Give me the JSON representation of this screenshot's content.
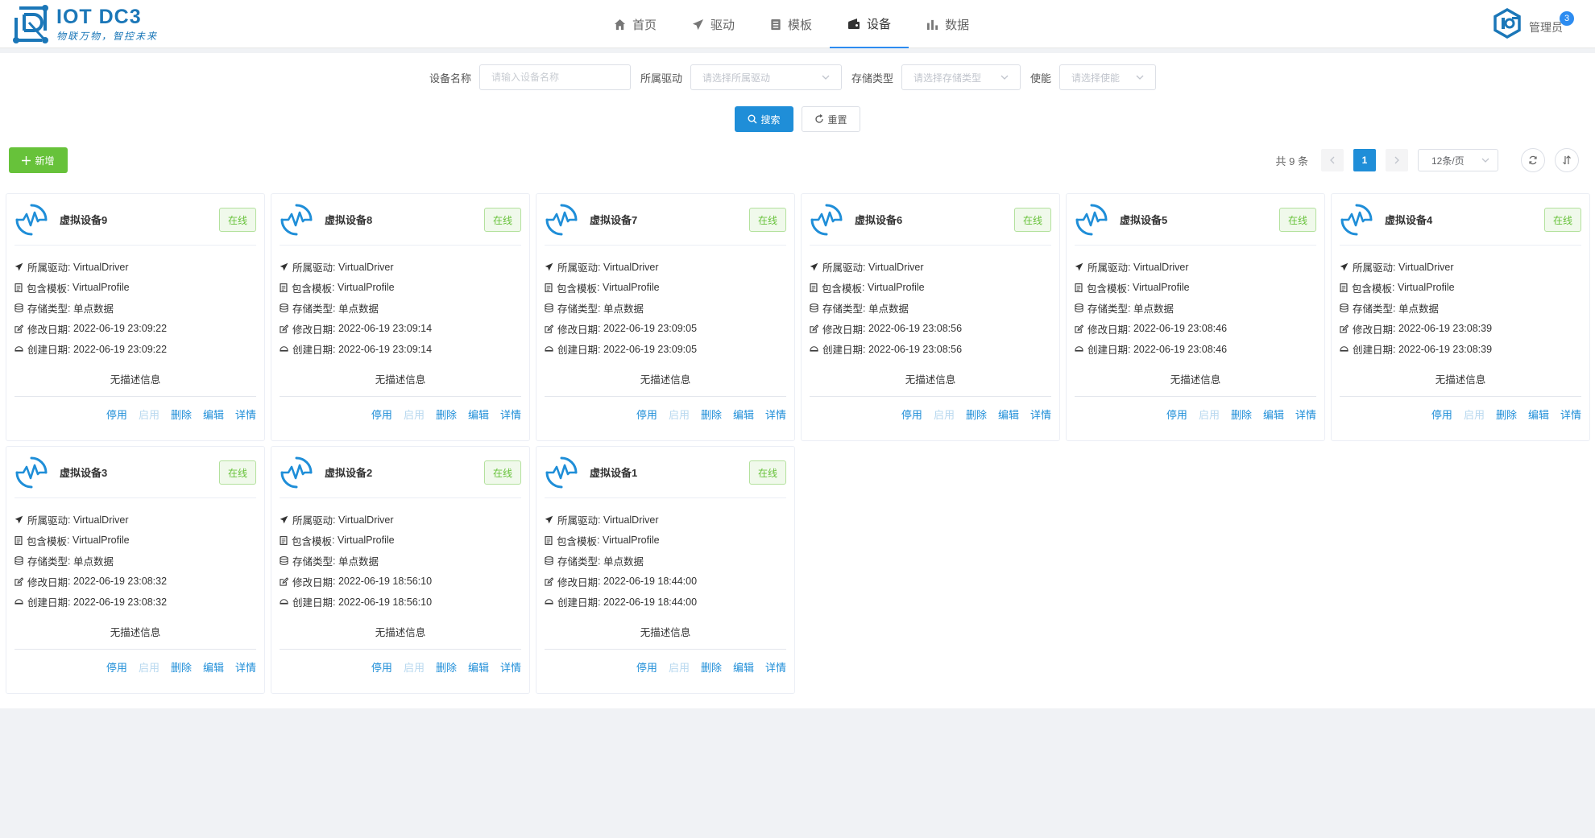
{
  "app": {
    "title": "IOT DC3",
    "slogan": "物联万物，智控未来"
  },
  "nav": [
    {
      "label": "首页",
      "icon": "home-icon",
      "active": false
    },
    {
      "label": "驱动",
      "icon": "send-icon",
      "active": false
    },
    {
      "label": "模板",
      "icon": "template-icon",
      "active": false
    },
    {
      "label": "设备",
      "icon": "device-icon",
      "active": true
    },
    {
      "label": "数据",
      "icon": "bar-chart-icon",
      "active": false
    }
  ],
  "user": {
    "name": "管理员",
    "badge": "3"
  },
  "search": {
    "name_label": "设备名称",
    "name_placeholder": "请输入设备名称",
    "driver_label": "所属驱动",
    "driver_placeholder": "请选择所属驱动",
    "storage_label": "存储类型",
    "storage_placeholder": "请选择存储类型",
    "enable_label": "使能",
    "enable_placeholder": "请选择使能",
    "search_btn": "搜索",
    "reset_btn": "重置"
  },
  "toolbar": {
    "add_btn": "新增"
  },
  "pager": {
    "total": "共 9 条",
    "current": "1",
    "size": "12条/页"
  },
  "colors": {
    "primary": "#1f8ed8",
    "success": "#67c23a",
    "logo": "#1b77b8"
  },
  "card_labels": {
    "driver": "所属驱动",
    "profile": "包含模板",
    "storage": "存储类型",
    "update": "修改日期",
    "create": "创建日期",
    "status": "在线",
    "desc": "无描述信息",
    "stop": "停用",
    "start": "启用",
    "delete": "删除",
    "edit": "编辑",
    "detail": "详情"
  },
  "devices": [
    {
      "name": "虚拟设备9",
      "driver": "VirtualDriver",
      "profile": "VirtualProfile",
      "storage": "单点数据",
      "update": "2022-06-19 23:09:22",
      "create": "2022-06-19 23:09:22"
    },
    {
      "name": "虚拟设备8",
      "driver": "VirtualDriver",
      "profile": "VirtualProfile",
      "storage": "单点数据",
      "update": "2022-06-19 23:09:14",
      "create": "2022-06-19 23:09:14"
    },
    {
      "name": "虚拟设备7",
      "driver": "VirtualDriver",
      "profile": "VirtualProfile",
      "storage": "单点数据",
      "update": "2022-06-19 23:09:05",
      "create": "2022-06-19 23:09:05"
    },
    {
      "name": "虚拟设备6",
      "driver": "VirtualDriver",
      "profile": "VirtualProfile",
      "storage": "单点数据",
      "update": "2022-06-19 23:08:56",
      "create": "2022-06-19 23:08:56"
    },
    {
      "name": "虚拟设备5",
      "driver": "VirtualDriver",
      "profile": "VirtualProfile",
      "storage": "单点数据",
      "update": "2022-06-19 23:08:46",
      "create": "2022-06-19 23:08:46"
    },
    {
      "name": "虚拟设备4",
      "driver": "VirtualDriver",
      "profile": "VirtualProfile",
      "storage": "单点数据",
      "update": "2022-06-19 23:08:39",
      "create": "2022-06-19 23:08:39"
    },
    {
      "name": "虚拟设备3",
      "driver": "VirtualDriver",
      "profile": "VirtualProfile",
      "storage": "单点数据",
      "update": "2022-06-19 23:08:32",
      "create": "2022-06-19 23:08:32"
    },
    {
      "name": "虚拟设备2",
      "driver": "VirtualDriver",
      "profile": "VirtualProfile",
      "storage": "单点数据",
      "update": "2022-06-19 18:56:10",
      "create": "2022-06-19 18:56:10"
    },
    {
      "name": "虚拟设备1",
      "driver": "VirtualDriver",
      "profile": "VirtualProfile",
      "storage": "单点数据",
      "update": "2022-06-19 18:44:00",
      "create": "2022-06-19 18:44:00"
    }
  ]
}
